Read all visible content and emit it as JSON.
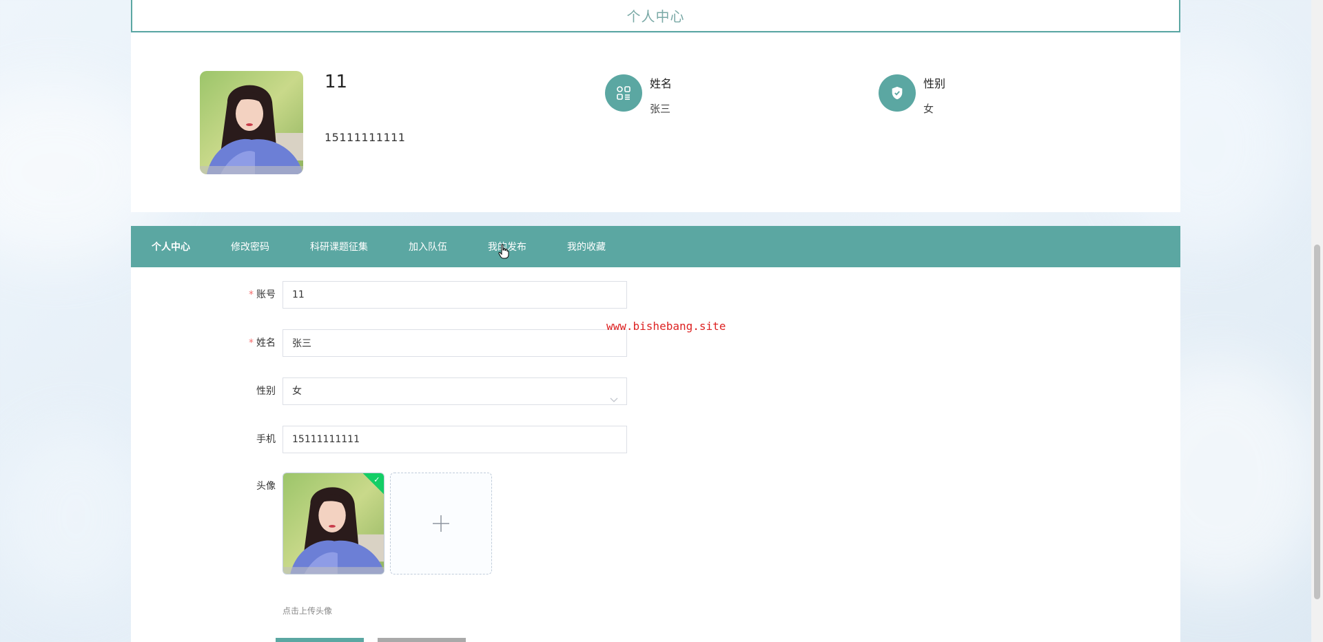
{
  "header": {
    "title": "个人中心"
  },
  "profile": {
    "username": "11",
    "phone": "15111111111",
    "name_label": "姓名",
    "name_value": "张三",
    "gender_label": "性别",
    "gender_value": "女"
  },
  "tabs": [
    {
      "label": "个人中心",
      "active": true
    },
    {
      "label": "修改密码",
      "active": false
    },
    {
      "label": "科研课题征集",
      "active": false
    },
    {
      "label": "加入队伍",
      "active": false
    },
    {
      "label": "我的发布",
      "active": false
    },
    {
      "label": "我的收藏",
      "active": false
    }
  ],
  "form": {
    "account_label": "账号",
    "account_value": "11",
    "name_label": "姓名",
    "name_value": "张三",
    "gender_label": "性别",
    "gender_value": "女",
    "phone_label": "手机",
    "phone_value": "15111111111",
    "avatar_label": "头像",
    "avatar_hint": "点击上传头像",
    "required_mark": "*"
  },
  "watermark": "www.bishebang.site",
  "colors": {
    "accent": "#5ba7a2",
    "required": "#f56c6c",
    "success": "#13ce66",
    "watermark": "#dd2222"
  }
}
